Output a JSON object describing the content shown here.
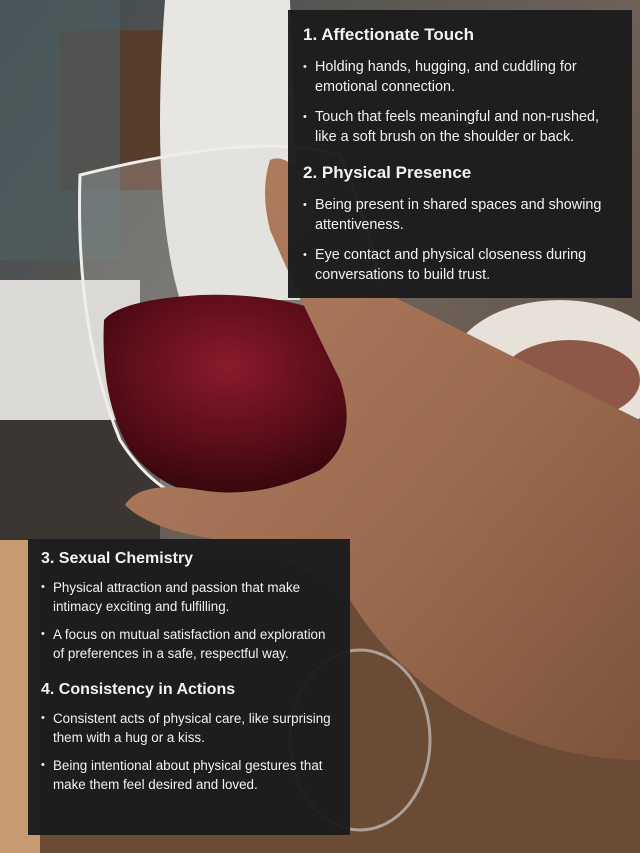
{
  "sections": [
    {
      "heading": "1. Affectionate Touch",
      "bullets": [
        "Holding hands, hugging, and cuddling for emotional connection.",
        "Touch that feels meaningful and non-rushed, like a soft brush on the shoulder or back."
      ]
    },
    {
      "heading": "2. Physical Presence",
      "bullets": [
        "Being present in shared spaces and showing attentiveness.",
        "Eye contact and physical closeness during conversations to build trust."
      ]
    },
    {
      "heading": "3. Sexual Chemistry",
      "bullets": [
        "Physical attraction and passion that make intimacy exciting and fulfilling.",
        "A focus on mutual satisfaction and exploration of preferences in a safe, respectful way."
      ]
    },
    {
      "heading": "4. Consistency in Actions",
      "bullets": [
        "Consistent acts of physical care, like surprising them with a hug or a kiss.",
        "Being intentional about physical gestures that make them feel desired and loved."
      ]
    }
  ],
  "colors": {
    "card_background": "#1c1c1e",
    "card_text": "#f2f2f2",
    "wine": "#5a0d18"
  }
}
